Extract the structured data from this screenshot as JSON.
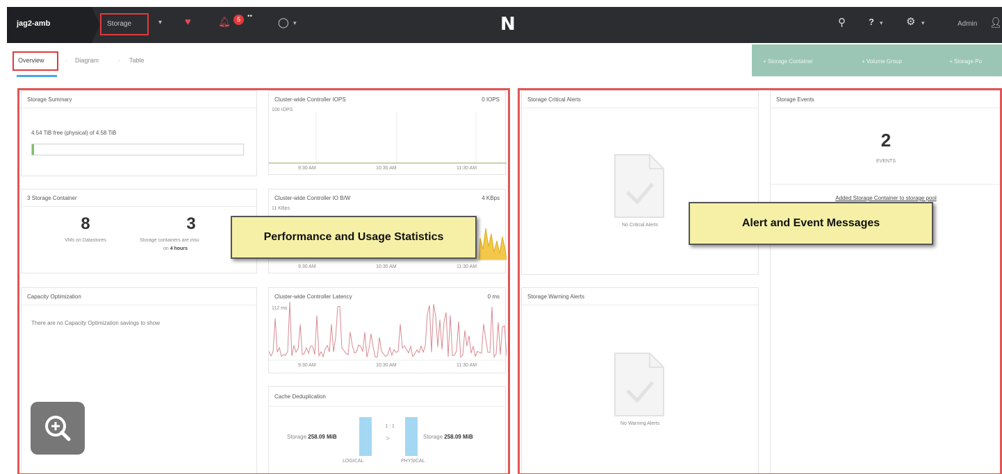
{
  "topbar": {
    "cluster_name": "jag2-amb",
    "current_view": "Storage",
    "alert_count": "5",
    "logo": "N",
    "admin_label": "Admin",
    "icons": [
      "heart-icon",
      "bell-icon",
      "circle-icon",
      "search-icon",
      "help-icon",
      "gear-icon",
      "user-icon"
    ]
  },
  "subnav": {
    "tabs": [
      {
        "label": "Overview",
        "active": true
      },
      {
        "label": "Diagram"
      },
      {
        "label": "Table"
      }
    ],
    "separator": "·",
    "actions": [
      "+ Storage Container",
      "+ Volume Group",
      "+ Storage Po"
    ]
  },
  "storage_summary": {
    "title": "Storage Summary",
    "usage_text": "4.54 TiB free (physical) of 4.58 TiB",
    "used_fraction": 0.01
  },
  "storage_container": {
    "title": "3 Storage Container",
    "vms_value": "8",
    "vms_label": "VMs on Datastores",
    "containers_value": "3",
    "containers_label": "Storage containers are insu",
    "containers_sub": "on",
    "containers_hours": "4 hours"
  },
  "capacity_optimization": {
    "title": "Capacity Optimization",
    "empty_text": "There are no Capacity Optimization savings to show"
  },
  "iops_chart": {
    "title": "Cluster-wide Controller IOPS",
    "value": "0 IOPS",
    "y_label": "100 IOPS",
    "x_ticks": [
      "9:30 AM",
      "10:30 AM",
      "11:30 AM"
    ]
  },
  "bw_chart": {
    "title": "Cluster-wide Controller IO B/W",
    "value": "4 KBps",
    "y_label": "11 KBps",
    "x_ticks": [
      "9:30 AM",
      "10:30 AM",
      "11:30 AM"
    ]
  },
  "latency_chart": {
    "title": "Cluster-wide Controller Latency",
    "value": "0 ms",
    "y_label": "112 ms",
    "x_ticks": [
      "9:30 AM",
      "10:30 AM",
      "11:30 AM"
    ]
  },
  "cache_dedup": {
    "title": "Cache Deduplication",
    "left_prefix": "Storage",
    "left_value": "258.09 MiB",
    "right_prefix": "Storage",
    "right_value": "258.09 MiB",
    "ratio": "1 : 1",
    "arrow": ">",
    "logical_label": "LOGICAL",
    "physical_label": "PHYSICAL"
  },
  "critical_alerts": {
    "title": "Storage Critical Alerts",
    "empty_text": "No Critical Alerts"
  },
  "warning_alerts": {
    "title": "Storage Warning Alerts",
    "empty_text": "No Warning Alerts"
  },
  "storage_events": {
    "title": "Storage Events",
    "count": "2",
    "count_label": "EVENTS",
    "event_link": "Added Storage Container to storage pool"
  },
  "callouts": {
    "perf": "Performance and Usage Statistics",
    "alerts": "Alert and Event Messages"
  },
  "colors": {
    "topbar": "#2b2d31",
    "accent_red": "#e03a3a",
    "action_bar": "#9bc6b5",
    "tab_underline": "#47a7e3",
    "callout_bg": "#f5f0a6",
    "latency_line": "#d98a93",
    "bw_area": "#f3c84a",
    "dedup_bar": "#a4d8f2"
  }
}
